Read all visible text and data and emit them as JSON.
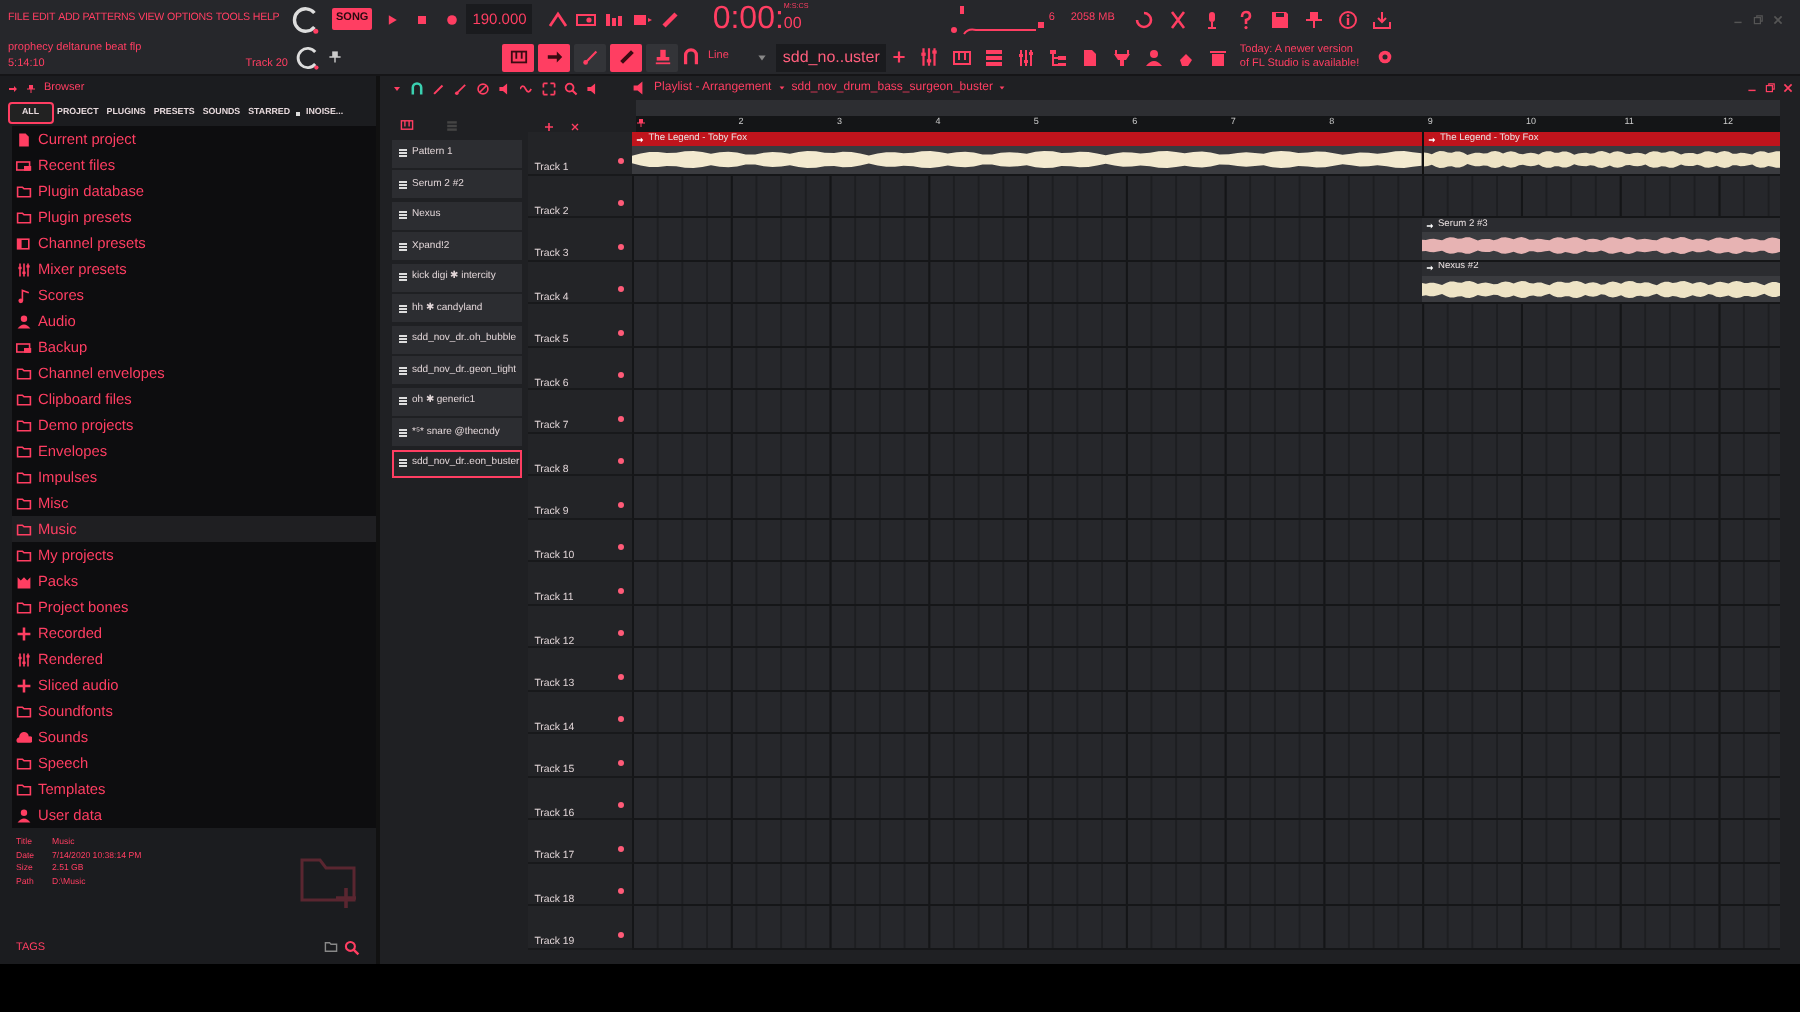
{
  "menu": [
    "FILE",
    "EDIT",
    "ADD",
    "PATTERNS",
    "VIEW",
    "OPTIONS",
    "TOOLS",
    "HELP"
  ],
  "project": {
    "title": "prophecy deltarune beat flp",
    "time": "5:14:10",
    "track": "Track 20"
  },
  "transport": {
    "mode": "SONG",
    "tempo": "190.000",
    "time": "0:00:",
    "time_cs": "00",
    "time_label": "M:S:CS"
  },
  "monitor": {
    "cpu": "6",
    "memory": "2058 MB"
  },
  "tool_toggles": [
    {
      "on": true
    },
    {
      "on": true
    },
    {
      "on": false
    },
    {
      "on": true
    },
    {
      "on": false
    }
  ],
  "snap": "Line",
  "pattern": "sdd_no..uster",
  "notice": "Today: A newer version of FL Studio is available!",
  "browser": {
    "title": "Browser",
    "tabs": [
      {
        "label": "ALL",
        "selected": true
      },
      {
        "label": "PROJECT",
        "selected": false
      },
      {
        "label": "PLUGINS",
        "selected": false
      },
      {
        "label": "PRESETS",
        "selected": false
      },
      {
        "label": "SOUNDS",
        "selected": false
      },
      {
        "label": "STARRED",
        "selected": false
      },
      {
        "label": "INOISE...",
        "selected": false
      }
    ],
    "items": [
      {
        "label": "Current project",
        "kind": "file",
        "selected": false
      },
      {
        "label": "Recent files",
        "kind": "drive",
        "selected": false
      },
      {
        "label": "Plugin database",
        "kind": "plugin",
        "selected": false
      },
      {
        "label": "Plugin presets",
        "kind": "plugin",
        "selected": false
      },
      {
        "label": "Channel presets",
        "kind": "channel",
        "selected": false
      },
      {
        "label": "Mixer presets",
        "kind": "mixer",
        "selected": false
      },
      {
        "label": "Scores",
        "kind": "note",
        "selected": false
      },
      {
        "label": "Audio",
        "kind": "person",
        "selected": false
      },
      {
        "label": "Backup",
        "kind": "drive",
        "selected": false
      },
      {
        "label": "Channel envelopes",
        "kind": "folder",
        "selected": false
      },
      {
        "label": "Clipboard files",
        "kind": "folder",
        "selected": false
      },
      {
        "label": "Demo projects",
        "kind": "folder",
        "selected": false
      },
      {
        "label": "Envelopes",
        "kind": "folder",
        "selected": false
      },
      {
        "label": "Impulses",
        "kind": "folder",
        "selected": false
      },
      {
        "label": "Misc",
        "kind": "folder",
        "selected": false
      },
      {
        "label": "Music",
        "kind": "folder",
        "selected": true
      },
      {
        "label": "My projects",
        "kind": "folder",
        "selected": false
      },
      {
        "label": "Packs",
        "kind": "pack",
        "selected": false
      },
      {
        "label": "Project bones",
        "kind": "folder",
        "selected": false
      },
      {
        "label": "Recorded",
        "kind": "plus",
        "selected": false
      },
      {
        "label": "Rendered",
        "kind": "mixer",
        "selected": false
      },
      {
        "label": "Sliced audio",
        "kind": "plus",
        "selected": false
      },
      {
        "label": "Soundfonts",
        "kind": "folder",
        "selected": false
      },
      {
        "label": "Sounds",
        "kind": "cloud",
        "selected": false
      },
      {
        "label": "Speech",
        "kind": "folder",
        "selected": false
      },
      {
        "label": "Templates",
        "kind": "folder",
        "selected": false
      },
      {
        "label": "User data",
        "kind": "person",
        "selected": false
      }
    ],
    "info": [
      {
        "label": "Title",
        "value": "Music"
      },
      {
        "label": "Date",
        "value": "7/14/2020 10:38:14 PM"
      },
      {
        "label": "Size",
        "value": "2.51 GB"
      },
      {
        "label": "Path",
        "value": "D:\\Music"
      }
    ],
    "tags": "TAGS"
  },
  "patterns": [
    {
      "label": "Pattern 1",
      "selected": false
    },
    {
      "label": "Serum 2 #2",
      "selected": false
    },
    {
      "label": "Nexus",
      "selected": false
    },
    {
      "label": "Xpand!2",
      "selected": false
    },
    {
      "label": "kick digi ✱ intercity",
      "selected": false
    },
    {
      "label": "hh ✱ candyland",
      "selected": false
    },
    {
      "label": "sdd_nov_dr..oh_bubble",
      "selected": false
    },
    {
      "label": "sdd_nov_dr..geon_tight",
      "selected": false
    },
    {
      "label": "oh ✱ generic1",
      "selected": false
    },
    {
      "label": "*⁵* snare @thecndy",
      "selected": false
    },
    {
      "label": "sdd_nov_dr..eon_buster",
      "selected": true
    }
  ],
  "playlist": {
    "title": "Playlist - Arrangement",
    "pattern": "sdd_nov_drum_bass_surgeon_buster",
    "bars": [
      "2",
      "3",
      "4",
      "5",
      "6",
      "7",
      "8",
      "9",
      "10",
      "11",
      "12"
    ],
    "tracks": [
      {
        "name": "Track 1",
        "clips": [
          {
            "label": "The Legend - Toby Fox",
            "color": "#c0141c"
          },
          {
            "label": "The Legend - Toby Fox",
            "color": "#c0141c"
          }
        ]
      },
      {
        "name": "Track 2"
      },
      {
        "name": "Track 3",
        "clips": [
          {
            "label": "Serum 2 #3",
            "color": "#2b2c30"
          }
        ]
      },
      {
        "name": "Track 4",
        "clips": [
          {
            "label": "Nexus #2",
            "color": "#2b2c30"
          }
        ]
      },
      {
        "name": "Track 5"
      },
      {
        "name": "Track 6"
      },
      {
        "name": "Track 7"
      },
      {
        "name": "Track 8"
      },
      {
        "name": "Track 9"
      },
      {
        "name": "Track 10"
      },
      {
        "name": "Track 11"
      },
      {
        "name": "Track 12"
      },
      {
        "name": "Track 13"
      },
      {
        "name": "Track 14"
      },
      {
        "name": "Track 15"
      },
      {
        "name": "Track 16"
      },
      {
        "name": "Track 17"
      },
      {
        "name": "Track 18"
      },
      {
        "name": "Track 19"
      }
    ]
  }
}
